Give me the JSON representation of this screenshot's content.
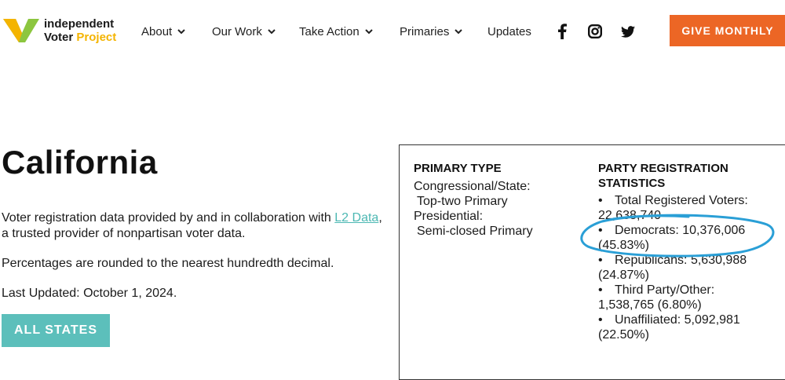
{
  "logo": {
    "line1": "independent",
    "line2a": "Voter",
    "line2b": "Project"
  },
  "nav": {
    "about": "About",
    "our_work": "Our Work",
    "take_action": "Take Action",
    "primaries": "Primaries",
    "updates": "Updates"
  },
  "social": [
    "facebook-icon",
    "instagram-icon",
    "twitter-icon"
  ],
  "give_button": "GIVE MONTHLY",
  "colors": {
    "accent_orange": "#ec6625",
    "teal": "#5cbfbb",
    "link": "#4cb8b3",
    "highlight": "#2a9fd6",
    "logo_green": "#8cc63f",
    "logo_yellow": "#f4b400"
  },
  "page": {
    "title": "California",
    "para1_before": "Voter registration data provided by and in collaboration with ",
    "para1_link": "L2 Data",
    "para1_after": ", a trusted provider of nonpartisan voter data.",
    "para2": "Percentages are rounded to the nearest hundredth decimal.",
    "para3": "Last Updated: October 1, 2024.",
    "all_states": "ALL STATES"
  },
  "panel": {
    "primary_type_heading": "PRIMARY TYPE",
    "primary_lines": [
      "Congressional/State:",
      "Top-two Primary",
      "Presidential:",
      "Semi-closed Primary"
    ],
    "party_heading": "PARTY REGISTRATION STATISTICS",
    "stats": [
      {
        "label": "Total Registered Voters:",
        "value": "22,638,740"
      },
      {
        "label": "Democrats: 10,376,006",
        "value": "(45.83%)"
      },
      {
        "label": "Republicans: 5,630,988",
        "value": "(24.87%)"
      },
      {
        "label": "Third Party/Other:",
        "value": "1,538,765 (6.80%)"
      },
      {
        "label": "Unaffiliated: 5,092,981",
        "value": "(22.50%)"
      }
    ],
    "bullet": "•"
  }
}
